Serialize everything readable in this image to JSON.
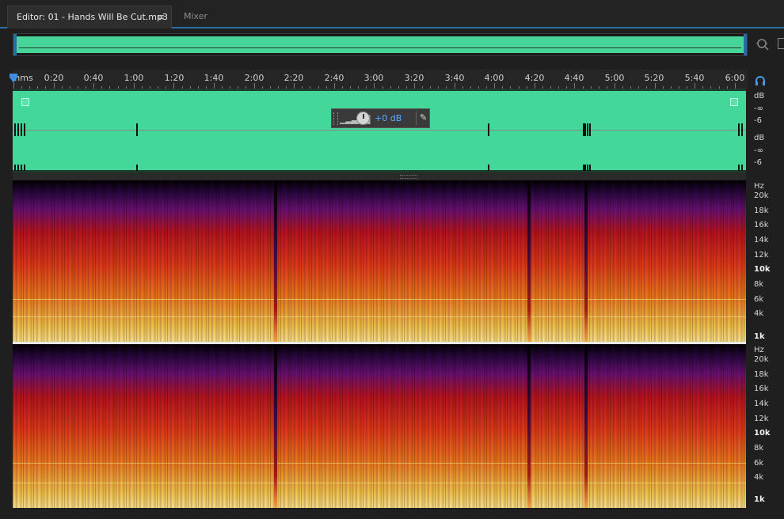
{
  "tabs": {
    "editor_label": "Editor: 01 - Hands Will Be Cut.mp3",
    "editor_menu_icon": "≡",
    "mixer_label": "Mixer"
  },
  "ruler": {
    "unit": "hms",
    "labels": [
      "0:20",
      "0:40",
      "1:00",
      "1:20",
      "1:40",
      "2:00",
      "2:20",
      "2:40",
      "3:00",
      "3:20",
      "3:40",
      "4:00",
      "4:20",
      "4:40",
      "5:00",
      "5:20",
      "5:40",
      "6:00"
    ]
  },
  "hud": {
    "value": "+0 dB"
  },
  "waveform_scale": {
    "top": {
      "unit": "dB",
      "inf": "-∞",
      "minus6": "-6"
    },
    "bottom": {
      "unit": "dB",
      "inf": "-∞",
      "minus6": "-6"
    }
  },
  "spectral_scale": {
    "top": {
      "unit": "Hz",
      "labels": [
        "20k",
        "18k",
        "16k",
        "14k",
        "12k",
        "10k",
        "8k",
        "6k",
        "4k",
        "1k"
      ]
    },
    "bottom": {
      "unit": "Hz",
      "labels": [
        "20k",
        "18k",
        "16k",
        "14k",
        "12k",
        "10k",
        "8k",
        "6k",
        "4k",
        "1k"
      ]
    }
  },
  "icons": {
    "zoom": "zoom-icon",
    "headphones": "headphones-icon",
    "pin": "pin-icon",
    "level-meter": "level-meter-icon"
  },
  "colors": {
    "waveform": "#43d899",
    "accent": "#2b6ea8",
    "hud_value": "#62a8ff"
  }
}
